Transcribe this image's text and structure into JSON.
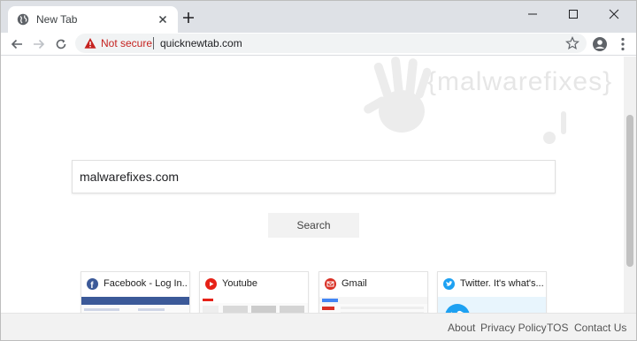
{
  "tab": {
    "title": "New Tab"
  },
  "omnibox": {
    "security_label": "Not secure",
    "url": "quicknewtab.com"
  },
  "watermark": {
    "text": "{malwarefixes}"
  },
  "search": {
    "value": "malwarefixes.com",
    "button_label": "Search"
  },
  "tiles": [
    {
      "label": "Facebook - Log In...",
      "icon": "facebook-icon",
      "color": "#3b5998"
    },
    {
      "label": "Youtube",
      "icon": "youtube-icon",
      "color": "#e62117"
    },
    {
      "label": "Gmail",
      "icon": "gmail-icon",
      "color": "#d93025"
    },
    {
      "label": "Twitter. It's what's...",
      "icon": "twitter-icon",
      "color": "#1da1f2"
    }
  ],
  "footer": {
    "links": [
      "About",
      "Privacy Policy",
      "TOS",
      "Contact Us"
    ]
  },
  "colors": {
    "tabstrip": "#dee1e6",
    "warning": "#c5221f",
    "footer_bg": "#f2f2f2"
  }
}
